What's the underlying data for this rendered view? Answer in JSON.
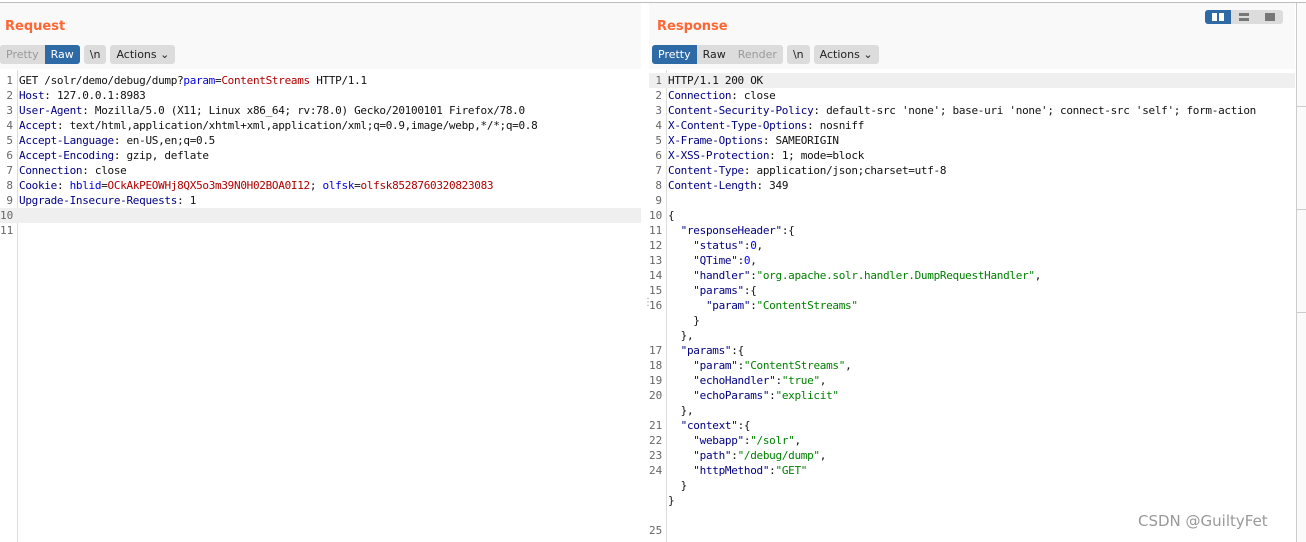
{
  "request": {
    "title": "Request",
    "tabs": [
      "Pretty",
      "Raw"
    ],
    "active_tab": "Raw",
    "newline_label": "\\n",
    "actions_label": "Actions",
    "lines": [
      {
        "n": "1",
        "tokens": [
          [
            "GET /solr/demo/debug/dump?",
            ""
          ],
          [
            "param",
            "pn"
          ],
          [
            "=",
            ""
          ],
          [
            "ContentStreams",
            "pv"
          ],
          [
            " HTTP/1.1",
            ""
          ]
        ]
      },
      {
        "n": "2",
        "tokens": [
          [
            "Host",
            "key"
          ],
          [
            ": 127.0.0.1:8983",
            ""
          ]
        ]
      },
      {
        "n": "3",
        "tokens": [
          [
            "User-Agent",
            "key"
          ],
          [
            ": Mozilla/5.0 (X11; Linux x86_64; rv:78.0) Gecko/20100101 Firefox/78.0",
            ""
          ]
        ]
      },
      {
        "n": "4",
        "tokens": [
          [
            "Accept",
            "key"
          ],
          [
            ": text/html,application/xhtml+xml,application/xml;q=0.9,image/webp,*/*;q=0.8",
            ""
          ]
        ]
      },
      {
        "n": "5",
        "tokens": [
          [
            "Accept-Language",
            "key"
          ],
          [
            ": en-US,en;q=0.5",
            ""
          ]
        ]
      },
      {
        "n": "6",
        "tokens": [
          [
            "Accept-Encoding",
            "key"
          ],
          [
            ": gzip, deflate",
            ""
          ]
        ]
      },
      {
        "n": "7",
        "tokens": [
          [
            "Connection",
            "key"
          ],
          [
            ": close",
            ""
          ]
        ]
      },
      {
        "n": "8",
        "tokens": [
          [
            "Cookie",
            "key"
          ],
          [
            ": ",
            ""
          ],
          [
            "hblid",
            "pn"
          ],
          [
            "=",
            ""
          ],
          [
            "OCkAkPEOWHj8QX5o3m39N0H02BOA0I12",
            "pv"
          ],
          [
            "; ",
            ""
          ],
          [
            "olfsk",
            "pn"
          ],
          [
            "=",
            ""
          ],
          [
            "olfsk8528760320823083",
            "pv"
          ]
        ]
      },
      {
        "n": "9",
        "tokens": [
          [
            "Upgrade-Insecure-Requests",
            "key"
          ],
          [
            ": 1",
            ""
          ]
        ]
      },
      {
        "n": "10",
        "tokens": [],
        "highlight": true
      },
      {
        "n": "11",
        "tokens": []
      }
    ]
  },
  "response": {
    "title": "Response",
    "tabs": [
      "Pretty",
      "Raw",
      "Render"
    ],
    "active_tab": "Pretty",
    "newline_label": "\\n",
    "actions_label": "Actions",
    "lines": [
      {
        "n": "1",
        "tokens": [
          [
            "HTTP/1.1 200 OK",
            ""
          ]
        ],
        "highlight": true
      },
      {
        "n": "2",
        "tokens": [
          [
            "Connection",
            "key"
          ],
          [
            ": close",
            ""
          ]
        ]
      },
      {
        "n": "3",
        "tokens": [
          [
            "Content-Security-Policy",
            "key"
          ],
          [
            ": default-src 'none'; base-uri 'none'; connect-src 'self'; form-action",
            ""
          ]
        ]
      },
      {
        "n": "4",
        "tokens": [
          [
            "X-Content-Type-Options",
            "key"
          ],
          [
            ": nosniff",
            ""
          ]
        ]
      },
      {
        "n": "5",
        "tokens": [
          [
            "X-Frame-Options",
            "key"
          ],
          [
            ": SAMEORIGIN",
            ""
          ]
        ]
      },
      {
        "n": "6",
        "tokens": [
          [
            "X-XSS-Protection",
            "key"
          ],
          [
            ": 1; mode=block",
            ""
          ]
        ]
      },
      {
        "n": "7",
        "tokens": [
          [
            "Content-Type",
            "key"
          ],
          [
            ": application/json;charset=utf-8",
            ""
          ]
        ]
      },
      {
        "n": "8",
        "tokens": [
          [
            "Content-Length",
            "key"
          ],
          [
            ": 349",
            ""
          ]
        ]
      },
      {
        "n": "9",
        "tokens": []
      },
      {
        "n": "10",
        "tokens": [
          [
            "{",
            ""
          ]
        ]
      },
      {
        "n": "11",
        "tokens": [
          [
            "  ",
            ""
          ],
          [
            "\"responseHeader\"",
            "key"
          ],
          [
            ":{",
            ""
          ]
        ]
      },
      {
        "n": "12",
        "tokens": [
          [
            "    ",
            ""
          ],
          [
            "\"status\"",
            "key"
          ],
          [
            ":",
            ""
          ],
          [
            "0",
            "num"
          ],
          [
            ",",
            ""
          ]
        ]
      },
      {
        "n": "13",
        "tokens": [
          [
            "    ",
            ""
          ],
          [
            "\"QTime\"",
            "key"
          ],
          [
            ":",
            ""
          ],
          [
            "0",
            "num"
          ],
          [
            ",",
            ""
          ]
        ]
      },
      {
        "n": "14",
        "tokens": [
          [
            "    ",
            ""
          ],
          [
            "\"handler\"",
            "key"
          ],
          [
            ":",
            ""
          ],
          [
            "\"org.apache.solr.handler.DumpRequestHandler\"",
            "str"
          ],
          [
            ",",
            ""
          ]
        ]
      },
      {
        "n": "15",
        "tokens": [
          [
            "    ",
            ""
          ],
          [
            "\"params\"",
            "key"
          ],
          [
            ":{",
            ""
          ]
        ]
      },
      {
        "n": "16",
        "tokens": [
          [
            "      ",
            ""
          ],
          [
            "\"param\"",
            "key"
          ],
          [
            ":",
            ""
          ],
          [
            "\"ContentStreams\"",
            "str"
          ]
        ]
      },
      {
        "n": "",
        "tokens": [
          [
            "    }",
            ""
          ]
        ]
      },
      {
        "n": "",
        "tokens": [
          [
            "  },",
            ""
          ]
        ]
      },
      {
        "n": "17",
        "tokens": [
          [
            "  ",
            ""
          ],
          [
            "\"params\"",
            "key"
          ],
          [
            ":{",
            ""
          ]
        ]
      },
      {
        "n": "18",
        "tokens": [
          [
            "    ",
            ""
          ],
          [
            "\"param\"",
            "key"
          ],
          [
            ":",
            ""
          ],
          [
            "\"ContentStreams\"",
            "str"
          ],
          [
            ",",
            ""
          ]
        ]
      },
      {
        "n": "19",
        "tokens": [
          [
            "    ",
            ""
          ],
          [
            "\"echoHandler\"",
            "key"
          ],
          [
            ":",
            ""
          ],
          [
            "\"true\"",
            "str"
          ],
          [
            ",",
            ""
          ]
        ]
      },
      {
        "n": "20",
        "tokens": [
          [
            "    ",
            ""
          ],
          [
            "\"echoParams\"",
            "key"
          ],
          [
            ":",
            ""
          ],
          [
            "\"explicit\"",
            "str"
          ]
        ]
      },
      {
        "n": "",
        "tokens": [
          [
            "  },",
            ""
          ]
        ]
      },
      {
        "n": "21",
        "tokens": [
          [
            "  ",
            ""
          ],
          [
            "\"context\"",
            "key"
          ],
          [
            ":{",
            ""
          ]
        ]
      },
      {
        "n": "22",
        "tokens": [
          [
            "    ",
            ""
          ],
          [
            "\"webapp\"",
            "key"
          ],
          [
            ":",
            ""
          ],
          [
            "\"/solr\"",
            "str"
          ],
          [
            ",",
            ""
          ]
        ]
      },
      {
        "n": "23",
        "tokens": [
          [
            "    ",
            ""
          ],
          [
            "\"path\"",
            "key"
          ],
          [
            ":",
            ""
          ],
          [
            "\"/debug/dump\"",
            "str"
          ],
          [
            ",",
            ""
          ]
        ]
      },
      {
        "n": "24",
        "tokens": [
          [
            "    ",
            ""
          ],
          [
            "\"httpMethod\"",
            "key"
          ],
          [
            ":",
            ""
          ],
          [
            "\"GET\"",
            "str"
          ]
        ]
      },
      {
        "n": "",
        "tokens": [
          [
            "  }",
            ""
          ]
        ]
      },
      {
        "n": "",
        "tokens": [
          [
            "}",
            ""
          ]
        ]
      },
      {
        "n": "",
        "tokens": []
      },
      {
        "n": "25",
        "tokens": []
      }
    ]
  },
  "layout_toggle": {
    "options": [
      "side-by-side-icon",
      "stacked-icon",
      "single-icon"
    ],
    "active": "side-by-side-icon"
  },
  "watermark": "CSDN @GuiltyFet",
  "colors": {
    "accent": "#2e6aa6",
    "title": "#ff6633",
    "key": "#000080",
    "param_name": "#0000e0",
    "param_value": "#b00000",
    "string": "#008000",
    "number": "#0000ff"
  }
}
